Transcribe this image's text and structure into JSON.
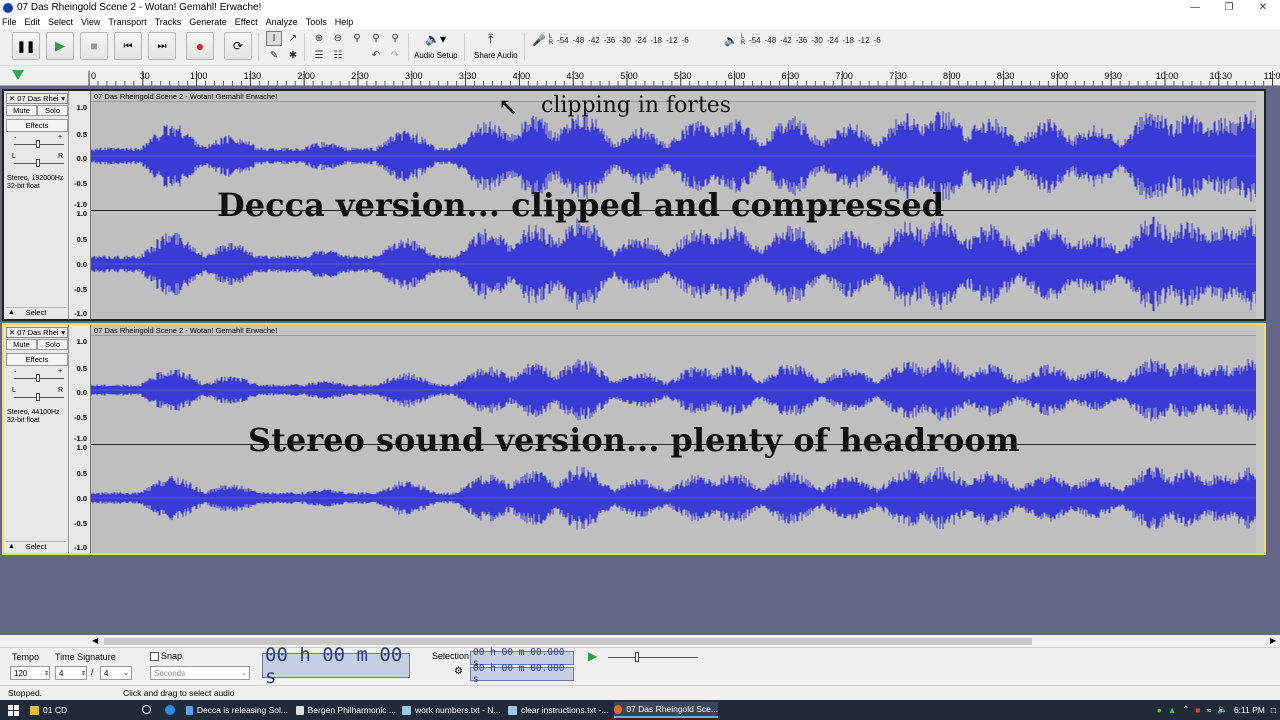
{
  "window": {
    "title": "07 Das Rheingold Scene 2 - Wotan! Gemahl! Erwache!"
  },
  "menu": [
    "File",
    "Edit",
    "Select",
    "View",
    "Transport",
    "Tracks",
    "Generate",
    "Effect",
    "Analyze",
    "Tools",
    "Help"
  ],
  "toolbar": {
    "audio_setup_label": "Audio Setup",
    "share_audio_label": "Share Audio",
    "meter_scale": [
      "-54",
      "-48",
      "-42",
      "-36",
      "-30",
      "-24",
      "-18",
      "-12",
      "-6"
    ],
    "meter_ch_left": "L",
    "meter_ch_right": "R"
  },
  "timeline": {
    "labels": [
      "0",
      "30",
      "1:00",
      "1:30",
      "2:00",
      "2:30",
      "3:00",
      "3:30",
      "4:00",
      "4:30",
      "5:00",
      "5:30",
      "6:00",
      "6:30",
      "7:00",
      "7:30",
      "8:00",
      "8:30",
      "9:00",
      "9:30",
      "10:00",
      "10:30",
      "11:00"
    ]
  },
  "tracks": [
    {
      "name": "07 Das Rhei",
      "clip_title": "07 Das Rheingold Scene 2 - Wotan! Gemahl! Erwache!",
      "mute": "Mute",
      "solo": "Solo",
      "effects": "Effects",
      "format_line1": "Stereo, 192000Hz",
      "format_line2": "32-bit float",
      "select": "Select",
      "gain_minus": "-",
      "gain_plus": "+",
      "pan_left": "L",
      "pan_right": "R",
      "scale_labels": [
        "1.0",
        "0.5",
        "0.0",
        "-0.5",
        "-1.0",
        "1.0",
        "0.5",
        "0.0",
        "-0.5",
        "-1.0"
      ],
      "waveform_amplitude": 0.92
    },
    {
      "name": "07 Das Rhei",
      "clip_title": "07 Das Rheingold Scene 2 - Wotan! Gemahl! Erwache!",
      "mute": "Mute",
      "solo": "Solo",
      "effects": "Effects",
      "format_line1": "Stereo, 44100Hz",
      "format_line2": "32-bit float",
      "select": "Select",
      "gain_minus": "-",
      "gain_plus": "+",
      "pan_left": "L",
      "pan_right": "R",
      "scale_labels": [
        "1.0",
        "0.5",
        "0.0",
        "-0.5",
        "-1.0",
        "1.0",
        "0.5",
        "0.0",
        "-0.5",
        "-1.0"
      ],
      "waveform_amplitude": 0.62
    }
  ],
  "annotations": {
    "clipping": "clipping in fortes",
    "decca": "Decca version... clipped and compressed",
    "stereo": "Stereo sound version... plenty of headroom"
  },
  "bottom": {
    "tempo_label": "Tempo",
    "tempo_value": "120",
    "time_sig_label": "Time Signature",
    "time_sig_num": "4",
    "time_sig_sep": "/",
    "time_sig_den": "4",
    "snap_label": "Snap",
    "snap_unit": "Seconds",
    "time_display": "00 h 00 m 00 s",
    "selection_label": "Selection",
    "sel_start": "00 h 00 m 00.000 s",
    "sel_end": "00 h 00 m 00.000 s"
  },
  "status": {
    "left": "Stopped.",
    "right": "Click and drag to select audio"
  },
  "taskbar": {
    "items": [
      "01 CD",
      "Decca is releasing Sol...",
      "Bergen Philharmonic ...",
      "work numbers.txt - N...",
      "clear instructions.txt -...",
      "07 Das Rheingold Sce..."
    ],
    "clock": "6:11 PM"
  },
  "colors": {
    "waveform": "#3a3ad6",
    "track_bg": "#bfbfbf",
    "project_bg": "#646888",
    "selected_border": "#f0e060"
  }
}
